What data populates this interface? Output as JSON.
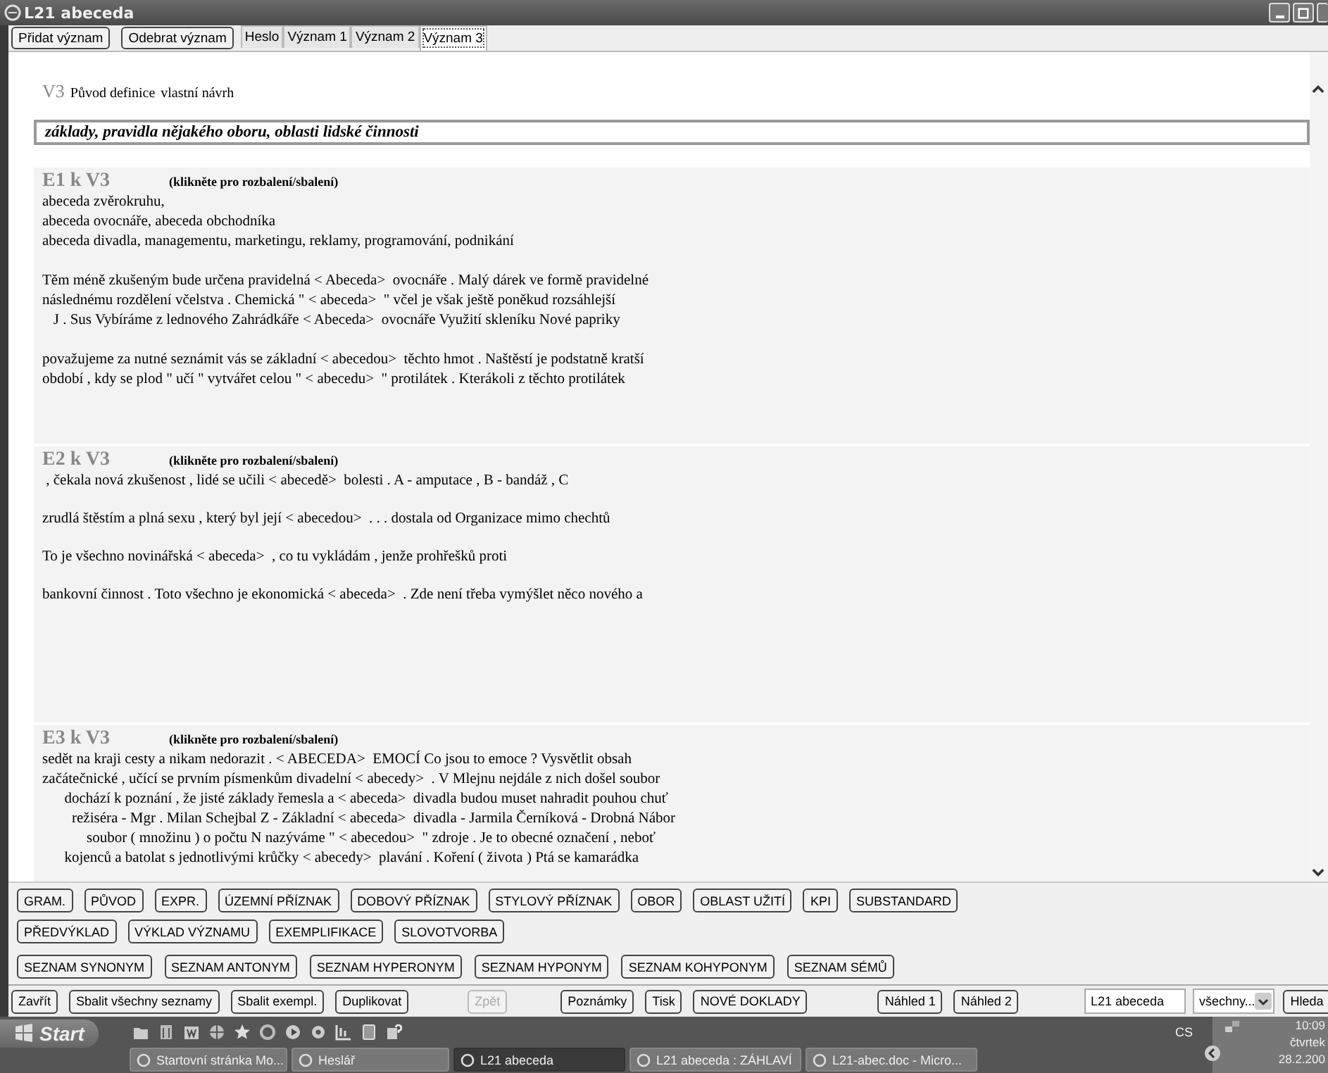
{
  "window": {
    "title": "L21 abeceda"
  },
  "toolbar": {
    "buttons": [
      "Přidat význam",
      "Odebrat význam"
    ],
    "tabs": [
      {
        "label": "Heslo",
        "selected": false
      },
      {
        "label": "Význam 1",
        "selected": false
      },
      {
        "label": "Význam 2",
        "selected": false
      },
      {
        "label": "Význam 3",
        "selected": true
      }
    ]
  },
  "meaning": {
    "code": "V3",
    "origin_label": "Původ definice",
    "origin_value": "vlastní návrh",
    "definition": "základy, pravidla nějakého oboru, oblasti lidské činnosti"
  },
  "examples": [
    {
      "heading": "E1 k V3",
      "hint": "(klikněte pro rozbalení/sbalení)",
      "paragraphs": [
        [
          "abeceda zvěrokruhu,",
          "abeceda ovocnáře, abeceda obchodníka",
          "abeceda divadla, managementu, marketingu, reklamy, programování, podnikání"
        ],
        [
          "Těm méně zkušeným bude určena pravidelná < Abeceda>  ovocnáře . Malý dárek ve formě pravidelné",
          "následnému rozdělení včelstva . Chemická \" < abeceda>  \" včel je však ještě poněkud rozsáhlejší",
          "   J . Sus Vybíráme z lednového Zahrádkáře < Abeceda>  ovocnáře Využití skleníku Nové papriky"
        ],
        [
          "považujeme za nutné seznámit vás se základní < abecedou>  těchto hmot . Naštěstí je podstatně kratší",
          "období , kdy se plod \" učí \" vytvářet celou \" < abecedu>  \" protilátek . Kterákoli z těchto protilátek"
        ]
      ]
    },
    {
      "heading": "E2 k V3",
      "hint": "(klikněte pro rozbalení/sbalení)",
      "paragraphs": [
        [
          " , čekala nová zkušenost , lidé se učili < abecedě>  bolesti . A - amputace , B - bandáž , C"
        ],
        [
          "zrudlá štěstím a plná sexu , který byl její < abecedou>  . . . dostala od Organizace mimo chechtů"
        ],
        [
          "To je všechno novinářská < abeceda>  , co tu vykládám , jenže prohřešků proti"
        ],
        [
          "bankovní činnost . Toto všechno je ekonomická < abeceda>  . Zde není třeba vymýšlet něco nového a"
        ]
      ]
    },
    {
      "heading": "E3 k V3",
      "hint": "(klikněte pro rozbalení/sbalení)",
      "paragraphs": [
        [
          "sedět na kraji cesty a nikam nedorazit . < ABECEDA>  EMOCÍ Co jsou to emoce ? Vysvětlit obsah",
          "začátečnické , učící se prvním písmenkům divadelní < abecedy>  . V Mlejnu nejdále z nich došel soubor",
          "      dochází k poznání , že jisté základy řemesla a < abeceda>  divadla budou muset nahradit pouhou chuť",
          "        režiséra - Mgr . Milan Schejbal Z - Základní < abeceda>  divadla - Jarmila Černíková - Drobná Nábor",
          "            soubor ( množinu ) o počtu N nazýváme \" < abecedou>  \" zdroje . Je to obecné označení , neboť",
          "      kojenců a batolat s jednotlivými krůčky < abecedy>  plavání . Koření ( života ) Ptá se kamarádka"
        ]
      ]
    }
  ],
  "section_buttons": [
    [
      "GRAM.",
      "PŮVOD",
      "EXPR.",
      "ÚZEMNÍ PŘÍZNAK",
      "DOBOVÝ PŘÍZNAK",
      "STYLOVÝ PŘÍZNAK",
      "OBOR",
      "OBLAST UŽITÍ",
      "KPI",
      "SUBSTANDARD"
    ],
    [
      "PŘEDVÝKLAD",
      "VÝKLAD VÝZNAMU",
      "EXEMPLIFIKACE",
      "SLOVOTVORBA"
    ],
    [
      "SEZNAM SYNONYM",
      "SEZNAM ANTONYM",
      "SEZNAM HYPERONYM",
      "SEZNAM HYPONYM",
      "SEZNAM KOHYPONYM",
      "SEZNAM SÉMŮ"
    ]
  ],
  "bottom_bar": {
    "groups": [
      [
        {
          "label": "Zavřít",
          "disabled": false
        },
        {
          "label": "Sbalit všechny seznamy",
          "disabled": false
        },
        {
          "label": "Sbalit exempl.",
          "disabled": false
        },
        {
          "label": "Duplikovat",
          "disabled": false
        }
      ],
      [
        {
          "label": "Zpět",
          "disabled": true
        }
      ],
      [
        {
          "label": "Poznámky",
          "disabled": false
        },
        {
          "label": "Tisk",
          "disabled": false
        },
        {
          "label": "NOVÉ DOKLADY",
          "disabled": false
        }
      ],
      [
        {
          "label": "Náhled 1",
          "disabled": false
        },
        {
          "label": "Náhled 2",
          "disabled": false
        }
      ]
    ],
    "search_value": "L21 abeceda",
    "filter_value": "všechny...",
    "search_button": "Hleda"
  },
  "taskbar": {
    "start": "Start",
    "tasks": [
      {
        "label": "Startovní stránka Mo...",
        "selected": false
      },
      {
        "label": "Heslář",
        "selected": false
      },
      {
        "label": "L21 abeceda",
        "selected": true
      },
      {
        "label": "L21 abeceda : ZÁHLAVÍ",
        "selected": false
      },
      {
        "label": "L21-abec.doc - Micro...",
        "selected": false
      }
    ],
    "language": "CS",
    "time": "10:09",
    "day": "čtvrtek",
    "date": "28.2.200"
  }
}
